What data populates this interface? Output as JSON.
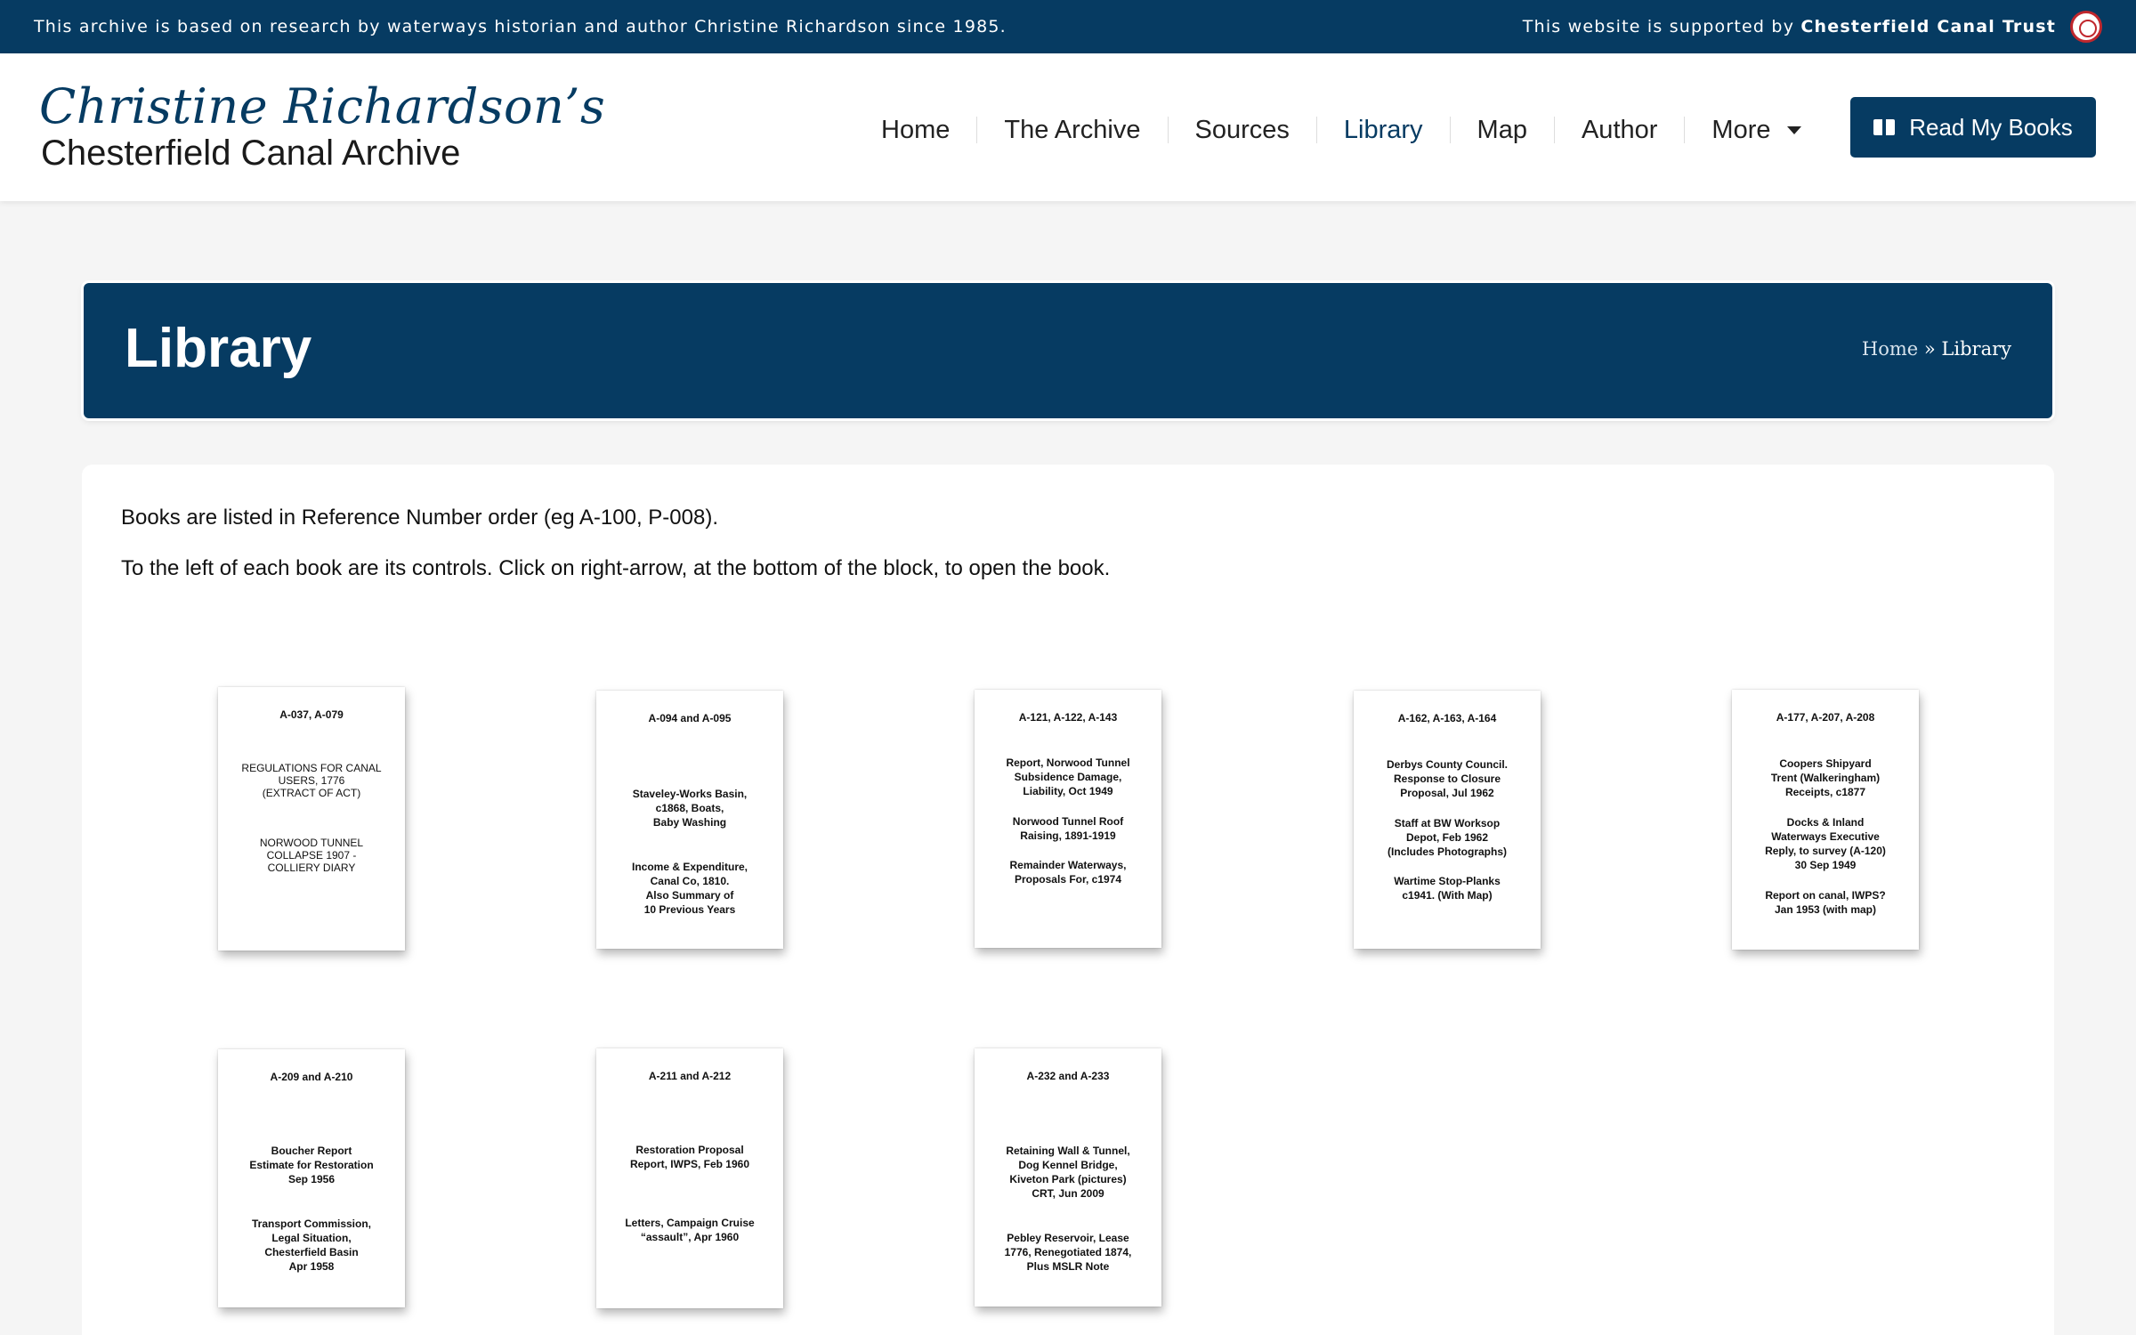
{
  "topbar": {
    "left_text": "This archive is based on research by waterways historian and author Christine Richardson since 1985.",
    "right_prefix": "This website is supported by ",
    "right_strong": "Chesterfield Canal Trust"
  },
  "logo": {
    "script": "Christine Richardson’s",
    "subtitle": "Chesterfield Canal Archive"
  },
  "nav": {
    "items": [
      "Home",
      "The Archive",
      "Sources",
      "Library",
      "Map",
      "Author",
      "More"
    ],
    "active": "Library",
    "cta_label": "Read My Books"
  },
  "banner": {
    "title": "Library",
    "breadcrumb_home": "Home",
    "breadcrumb_sep": " » ",
    "breadcrumb_current": "Library"
  },
  "intro": {
    "p1": "Books are listed in Reference Number order (eg A-100, P-008).",
    "p2": "To the left of each book are its controls.  Click on right-arrow, at the bottom of the block, to open the book."
  },
  "books": [
    {
      "ref": "A-037, A-079",
      "t1": "REGULATIONS FOR CANAL\nUSERS, 1776\n(EXTRACT OF ACT)",
      "t2": "NORWOOD  TUNNEL\nCOLLAPSE 1907  -\nCOLLIERY DIARY"
    },
    {
      "ref": "A-094   and   A-095",
      "t1": "Staveley-Works Basin,\nc1868, Boats,\nBaby Washing",
      "t2": "Income & Expenditure,\nCanal Co, 1810.\nAlso Summary of\n10 Previous Years"
    },
    {
      "ref": "A-121, A-122, A-143",
      "t1": "Report, Norwood Tunnel\nSubsidence Damage,\nLiability, Oct 1949",
      "t2": "Norwood Tunnel Roof\nRaising, 1891-1919",
      "t3": "Remainder Waterways,\nProposals For, c1974"
    },
    {
      "ref": "A-162, A-163, A-164",
      "t1": "Derbys County Council.\nResponse to Closure\nProposal, Jul 1962",
      "t2": "Staff at BW Worksop\nDepot, Feb 1962\n(Includes Photographs)",
      "t3": "Wartime Stop-Planks\nc1941. (With Map)"
    },
    {
      "ref": "A-177, A-207, A-208",
      "t1": "Coopers Shipyard\nTrent (Walkeringham)\nReceipts, c1877",
      "t2": "Docks & Inland\nWaterways Executive\nReply, to survey (A-120)\n30 Sep 1949",
      "t3": "Report on canal, IWPS?\nJan 1953 (with map)"
    },
    {
      "ref": "A-209   and   A-210",
      "t1": "Boucher Report\nEstimate for Restoration\nSep 1956",
      "t2": "Transport Commission,\nLegal Situation,\nChesterfield Basin\nApr 1958"
    },
    {
      "ref": "A-211   and   A-212",
      "t1": "Restoration Proposal\nReport, IWPS, Feb 1960",
      "t2": "Letters, Campaign Cruise\n“assault”, Apr 1960"
    },
    {
      "ref": "A-232   and   A-233",
      "t1": "Retaining Wall & Tunnel,\nDog Kennel Bridge,\nKiveton Park (pictures)\nCRT, Jun 2009",
      "t2": "Pebley Reservoir, Lease\n1776, Renegotiated 1874,\nPlus MSLR Note"
    }
  ]
}
